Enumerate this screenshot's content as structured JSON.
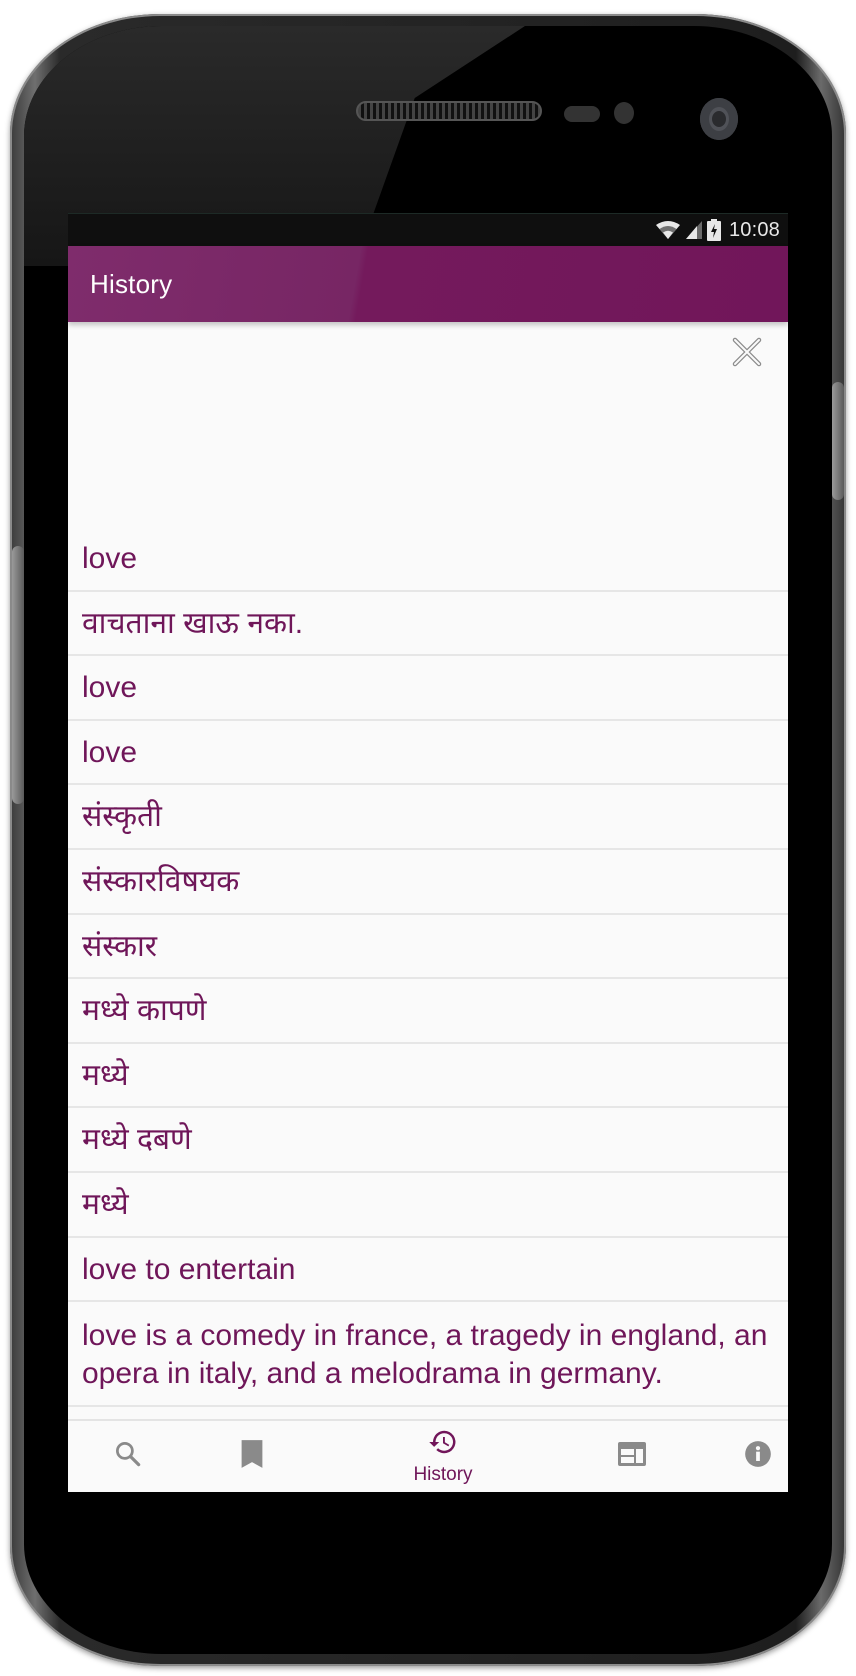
{
  "status_bar": {
    "time": "10:08",
    "icons": [
      "wifi-icon",
      "cellular-signal-icon",
      "battery-charging-icon"
    ]
  },
  "app_bar": {
    "title": "History"
  },
  "actions": {
    "clear_history_icon": "close-icon"
  },
  "history": {
    "items": [
      "love",
      "वाचताना खाऊ नका.",
      "love",
      "love",
      "संस्कृती",
      "संस्कारविषयक",
      "संस्कार",
      "मध्ये कापणे",
      "मध्ये",
      "मध्ये दबणे",
      "मध्ये",
      "love to entertain",
      "love is a comedy in france, a tragedy in england, an opera in italy, and a melodrama in germany."
    ]
  },
  "bottom_nav": {
    "items": [
      {
        "id": "search",
        "icon": "search-icon",
        "label": "",
        "active": false
      },
      {
        "id": "bookmarks",
        "icon": "bookmark-icon",
        "label": "",
        "active": false
      },
      {
        "id": "history",
        "icon": "history-icon",
        "label": "History",
        "active": true
      },
      {
        "id": "layout",
        "icon": "web-layout-icon",
        "label": "",
        "active": false
      },
      {
        "id": "info",
        "icon": "info-icon",
        "label": "",
        "active": false
      }
    ]
  },
  "colors": {
    "primary": "#71165a",
    "primary_light": "#7f2c6c",
    "list_text": "#6f1659",
    "inactive_icon": "#8a8a8a",
    "background": "#fafafa",
    "divider": "#e6e6e6"
  }
}
